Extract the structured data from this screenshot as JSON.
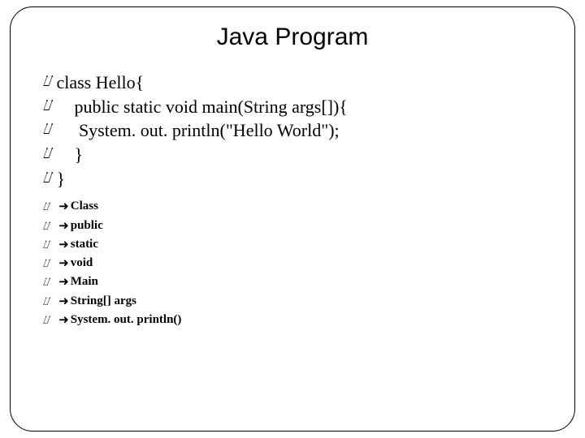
{
  "title": "Java Program",
  "code_lines": [
    "class Hello{",
    "    public static void main(String args[]){",
    "     System. out. println(\"Hello World\");",
    "    }",
    "}"
  ],
  "terms": [
    "Class",
    " public",
    " static",
    " void",
    " Main",
    " String[] args",
    " System. out. println()"
  ],
  "bullet_glyph": "༏",
  "arrow_glyph": "è",
  "page_number": ""
}
